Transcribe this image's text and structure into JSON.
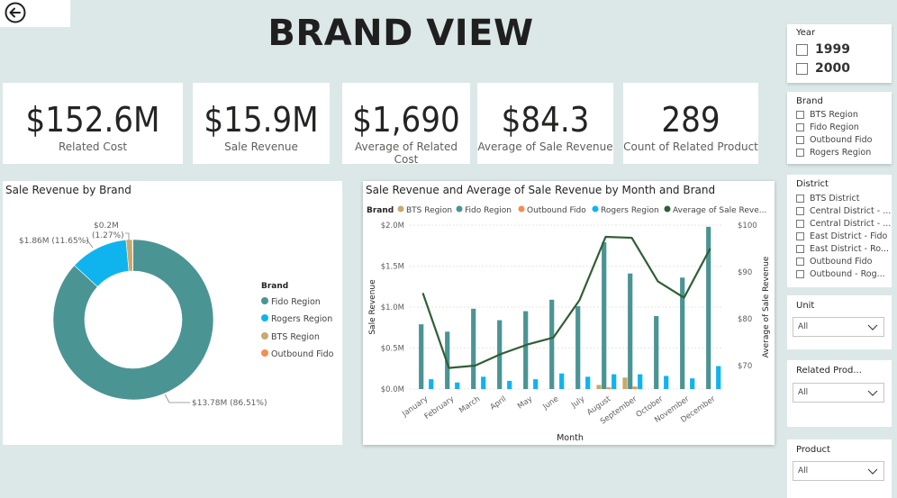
{
  "header": {
    "title": "BRAND VIEW"
  },
  "kpis": [
    {
      "value": "$152.6M",
      "label": "Related Cost"
    },
    {
      "value": "$15.9M",
      "label": "Sale Revenue"
    },
    {
      "value": "$1,690",
      "label": "Average of Related Cost"
    },
    {
      "value": "$84.3",
      "label": "Average of Sale Revenue"
    },
    {
      "value": "289",
      "label": "Count of Related Product"
    }
  ],
  "donut": {
    "title": "Sale Revenue by Brand",
    "legend_title": "Brand",
    "legend": [
      "Fido Region",
      "Rogers Region",
      "BTS Region",
      "Outbound Fido"
    ],
    "labels": {
      "fido": "$13.78M (86.51%)",
      "rogers": "$1.86M (11.65%)",
      "bts_value": "$0.2M",
      "bts_pct": "(1.27%)"
    }
  },
  "combo": {
    "title": "Sale Revenue and Average of Sale Revenue by Month and Brand",
    "legend_title": "Brand",
    "legend": [
      "BTS Region",
      "Fido Region",
      "Outbound Fido",
      "Rogers Region",
      "Average of Sale Reve..."
    ],
    "ylabel_left": "Sale Revenue",
    "ylabel_right": "Average of Sale Revenue",
    "xlabel": "Month"
  },
  "chart_data": {
    "type": "bar",
    "title": "Sale Revenue and Average of Sale Revenue by Month and Brand",
    "xlabel": "Month",
    "ylabel": "Sale Revenue",
    "y2label": "Average of Sale Revenue",
    "categories": [
      "January",
      "February",
      "March",
      "April",
      "May",
      "June",
      "July",
      "August",
      "September",
      "October",
      "November",
      "December"
    ],
    "ylim": [
      0,
      2000000
    ],
    "y_ticks": [
      "$0.0M",
      "$0.5M",
      "$1.0M",
      "$1.5M",
      "$2.0M"
    ],
    "y2lim": [
      65,
      100
    ],
    "y2_ticks": [
      "$70",
      "$80",
      "$90",
      "$100"
    ],
    "series": [
      {
        "name": "BTS Region",
        "color": "#c8a96e",
        "values": [
          0,
          0,
          0,
          0,
          0,
          0,
          0,
          50000,
          140000,
          0,
          0,
          0
        ]
      },
      {
        "name": "Fido Region",
        "color": "#4b9494",
        "values": [
          790000,
          700000,
          980000,
          840000,
          950000,
          1090000,
          1010000,
          1790000,
          1410000,
          890000,
          1360000,
          1980000
        ]
      },
      {
        "name": "Outbound Fido",
        "color": "#f28e4f",
        "values": [
          0,
          0,
          0,
          0,
          0,
          0,
          0,
          20000,
          30000,
          0,
          0,
          0
        ]
      },
      {
        "name": "Rogers Region",
        "color": "#0fb4ef",
        "values": [
          120000,
          80000,
          150000,
          100000,
          120000,
          190000,
          150000,
          180000,
          180000,
          160000,
          130000,
          280000
        ]
      },
      {
        "name": "Average of Sale Reve...",
        "color": "#2f5f35",
        "type": "line",
        "axis": "right",
        "values": [
          85.5,
          69.5,
          70,
          72.5,
          74.5,
          76,
          84,
          97.5,
          97.3,
          88,
          84.5,
          95
        ]
      }
    ]
  },
  "donut_data": {
    "type": "pie",
    "slices": [
      {
        "name": "Fido Region",
        "value": 13.78,
        "pct": 86.51,
        "color": "#4b9494"
      },
      {
        "name": "Rogers Region",
        "value": 1.86,
        "pct": 11.65,
        "color": "#0fb4ef"
      },
      {
        "name": "BTS Region",
        "value": 0.2,
        "pct": 1.27,
        "color": "#c8a96e"
      },
      {
        "name": "Outbound Fido",
        "value": 0.01,
        "pct": 0.08,
        "color": "#f28e4f"
      }
    ]
  },
  "slicers": {
    "year": {
      "title": "Year",
      "options": [
        "1999",
        "2000"
      ]
    },
    "brand": {
      "title": "Brand",
      "options": [
        "BTS Region",
        "Fido Region",
        "Outbound Fido",
        "Rogers Region"
      ]
    },
    "district": {
      "title": "District",
      "options": [
        "BTS District",
        "Central District - ...",
        "Central District - ...",
        "East District - Fido",
        "East District - Ro...",
        "Outbound Fido",
        "Outbound - Rog..."
      ]
    },
    "unit": {
      "title": "Unit",
      "value": "All"
    },
    "related_prod": {
      "title": "Related Prod...",
      "value": "All"
    },
    "product": {
      "title": "Product",
      "value": "All"
    }
  }
}
